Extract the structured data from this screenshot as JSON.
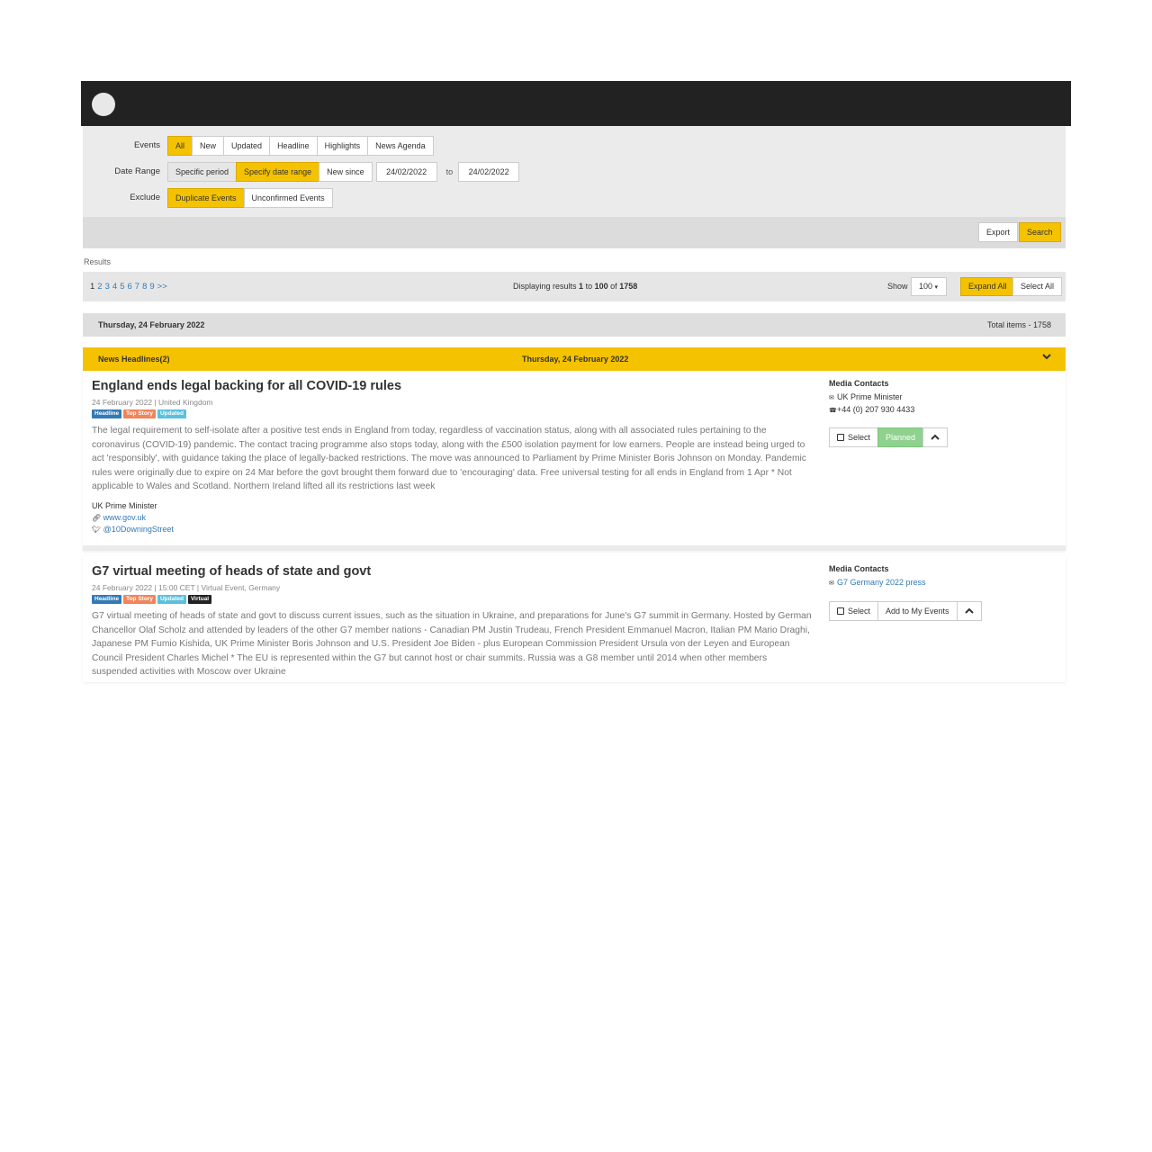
{
  "filters": {
    "events": {
      "label": "Events",
      "options": [
        "All",
        "New",
        "Updated",
        "Headline",
        "Highlights",
        "News Agenda"
      ],
      "selected": "All"
    },
    "date_range": {
      "label": "Date Range",
      "options": [
        "Specific period",
        "Specify date range",
        "New since"
      ],
      "selected": "Specify date range",
      "from": "24/02/2022",
      "to_label": "to",
      "to": "24/02/2022"
    },
    "exclude": {
      "label": "Exclude",
      "options": [
        "Duplicate Events",
        "Unconfirmed Events"
      ],
      "selected": "Duplicate Events"
    }
  },
  "actions": {
    "export": "Export",
    "search": "Search"
  },
  "results": {
    "label": "Results",
    "pages": [
      "1",
      "2",
      "3",
      "4",
      "5",
      "6",
      "7",
      "8",
      "9",
      ">>"
    ],
    "current_page": "1",
    "display_prefix": "Displaying results",
    "range_start": "1",
    "range_to": "to",
    "range_end": "100",
    "range_of": "of",
    "total": "1758",
    "show_label": "Show",
    "show_value": "100",
    "expand_all": "Expand All",
    "select_all": "Select All"
  },
  "day": {
    "date": "Thursday, 24 February 2022",
    "total_items": "Total items - 1758"
  },
  "section": {
    "title": "News Headlines(2)",
    "date": "Thursday, 24 February 2022"
  },
  "events": [
    {
      "title": "England ends legal backing for all COVID-19 rules",
      "meta": "24 February 2022  |  United Kingdom",
      "tags": [
        "Headline",
        "Top Story",
        "Updated"
      ],
      "body": "The legal requirement to self-isolate after a positive test ends in England from today, regardless of vaccination status, along with all associated rules pertaining to the coronavirus (COVID-19) pandemic. The contact tracing programme also stops today, along with the £500 isolation payment for low earners. People are instead being urged to act 'responsibly', with guidance taking the place of legally-backed restrictions. The move was announced to Parliament by Prime Minister Boris Johnson on Monday. Pandemic rules were originally due to expire on 24 Mar before the govt brought them forward due to 'encouraging' data. Free universal testing for all ends in England from 1 Apr * Not applicable to Wales and Scotland. Northern Ireland lifted all its restrictions last week",
      "org": "UK Prime Minister",
      "website": "www.gov.uk",
      "twitter": "@10DowningStreet",
      "media_contacts_label": "Media Contacts",
      "contact_email": "UK Prime Minister",
      "contact_phone": "+44 (0) 207 930 4433",
      "select_label": "Select",
      "status_label": "Planned"
    },
    {
      "title": "G7 virtual meeting of heads of state and govt",
      "meta": "24 February 2022  |  15:00 CET  |  Virtual Event, Germany",
      "tags": [
        "Headline",
        "Top Story",
        "Updated",
        "Virtual"
      ],
      "body": "G7 virtual meeting of heads of state and govt to discuss current issues, such as the situation in Ukraine, and preparations for June's G7 summit in Germany. Hosted by German Chancellor Olaf Scholz and attended by leaders of the other G7 member nations - Canadian PM Justin Trudeau, French President Emmanuel Macron, Italian PM Mario Draghi, Japanese PM Fumio Kishida, UK Prime Minister Boris Johnson and U.S. President Joe Biden - plus European Commission President Ursula von der Leyen and European Council President Charles Michel * The EU is represented within the G7 but cannot host or chair summits. Russia was a G8 member until 2014 when other members suspended activities with Moscow over Ukraine",
      "media_contacts_label": "Media Contacts",
      "contact_email": "G7 Germany 2022 press",
      "select_label": "Select",
      "status_label": "Add to My Events"
    }
  ],
  "colors": {
    "accent": "#f5c200",
    "header": "#222222",
    "link": "#337ab7",
    "planned": "#8fd18f"
  },
  "icons": [
    "logo-circle",
    "chevron-down-icon",
    "link-icon",
    "twitter-icon",
    "envelope-icon",
    "phone-icon",
    "checkbox-icon",
    "chevron-up-icon"
  ]
}
